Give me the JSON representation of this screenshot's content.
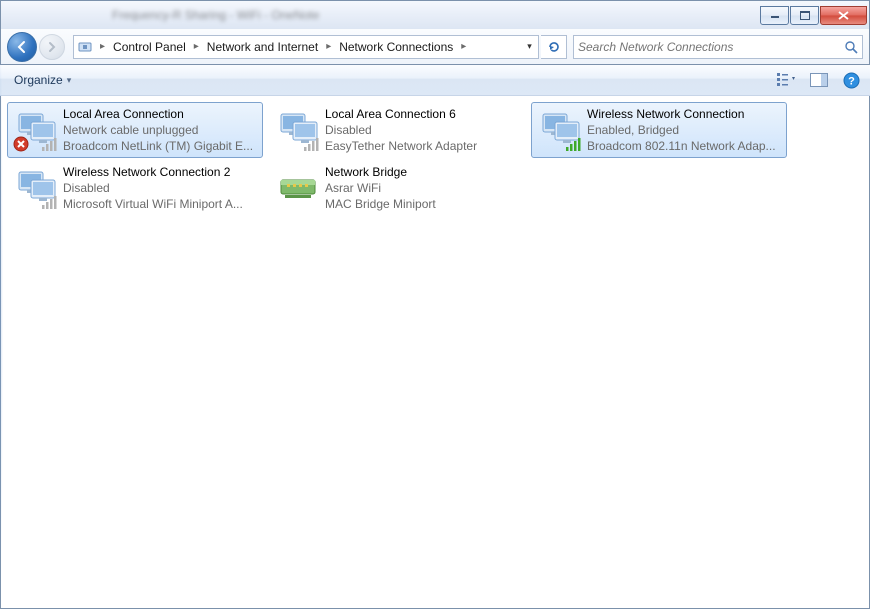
{
  "titlebar": {
    "blurred_title": "Frequency-R Sharing - WiFi - OneNote"
  },
  "breadcrumb": {
    "root_sep": "▸",
    "parts": [
      "Control Panel",
      "Network and Internet",
      "Network Connections"
    ]
  },
  "search": {
    "placeholder": "Search Network Connections"
  },
  "toolbar": {
    "organize_label": "Organize"
  },
  "items": [
    {
      "title": "Local Area Connection",
      "line2": "Network cable unplugged",
      "line3": "Broadcom NetLink (TM) Gigabit E...",
      "type": "eth",
      "overlay": "x",
      "bars": "gray",
      "selected": true
    },
    {
      "title": "Local Area Connection 6",
      "line2": "Disabled",
      "line3": "EasyTether Network Adapter",
      "type": "eth",
      "overlay": "none",
      "bars": "gray",
      "selected": false
    },
    {
      "title": "Wireless Network Connection",
      "line2": "Enabled, Bridged",
      "line3": "Broadcom 802.11n Network Adap...",
      "type": "wifi",
      "overlay": "none",
      "bars": "green",
      "selected": true
    },
    {
      "title": "Wireless Network Connection 2",
      "line2": "Disabled",
      "line3": "Microsoft Virtual WiFi Miniport A...",
      "type": "wifi",
      "overlay": "none",
      "bars": "gray",
      "selected": false
    },
    {
      "title": "Network Bridge",
      "line2": "Asrar WiFi",
      "line3": "MAC Bridge Miniport",
      "type": "bridge",
      "overlay": "none",
      "bars": "none",
      "selected": false
    }
  ]
}
